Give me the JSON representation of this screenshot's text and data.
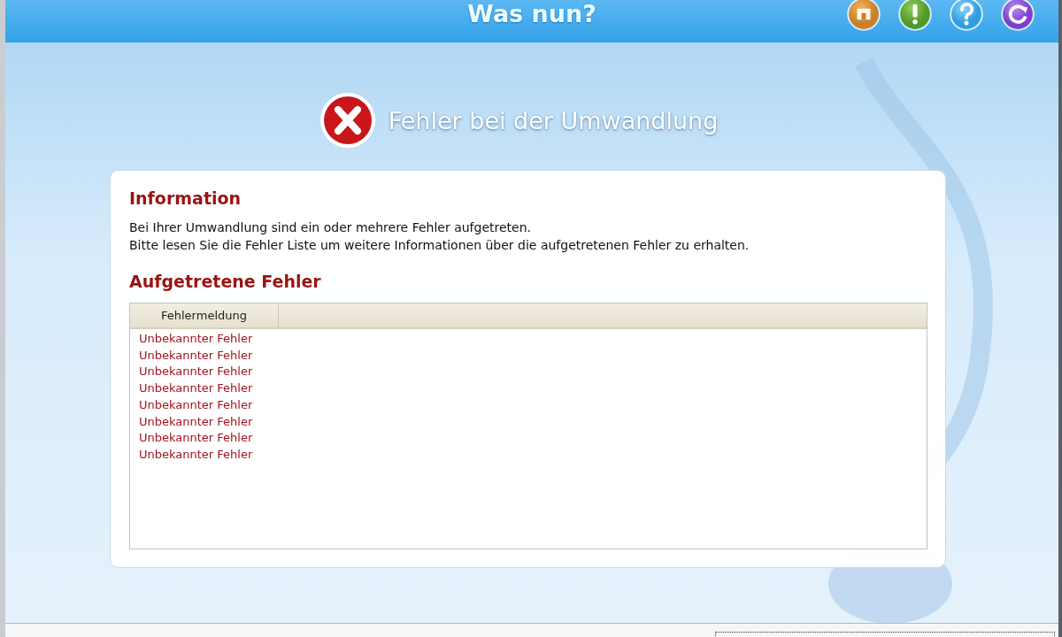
{
  "window": {
    "title": "Was nun?"
  },
  "toolbar": {
    "buttons": [
      {
        "kind": "home"
      },
      {
        "kind": "info"
      },
      {
        "kind": "help"
      },
      {
        "kind": "refresh"
      }
    ]
  },
  "heading": {
    "kind": "error",
    "text": "Fehler bei der Umwandlung"
  },
  "information": {
    "title": "Information",
    "lines": [
      "Bei Ihrer Umwandlung sind ein oder mehrere Fehler aufgetreten.",
      "Bitte lesen Sie die Fehler Liste um weitere Informationen über die aufgetretenen Fehler zu erhalten."
    ]
  },
  "errors": {
    "title": "Aufgetretene Fehler",
    "columns": [
      "Fehlermeldung"
    ],
    "rows": [
      [
        "Unbekannter Fehler"
      ],
      [
        "Unbekannter Fehler"
      ],
      [
        "Unbekannter Fehler"
      ],
      [
        "Unbekannter Fehler"
      ],
      [
        "Unbekannter Fehler"
      ],
      [
        "Unbekannter Fehler"
      ],
      [
        "Unbekannter Fehler"
      ],
      [
        "Unbekannter Fehler"
      ]
    ]
  }
}
